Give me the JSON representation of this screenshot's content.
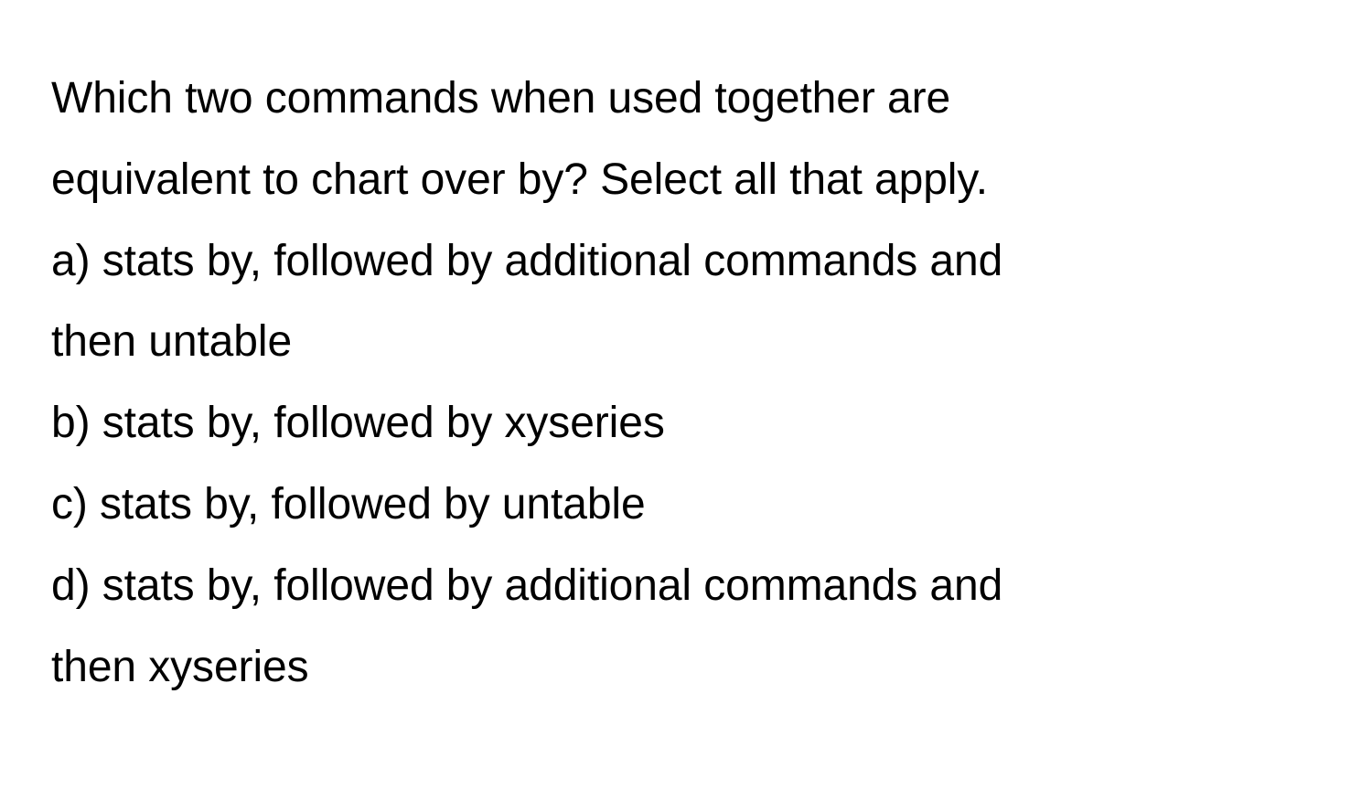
{
  "question": {
    "line1": "Which two commands when used together are",
    "line2": "equivalent to chart over by? Select all that apply."
  },
  "options": {
    "a_line1": "a) stats by, followed by additional commands and",
    "a_line2": "then untable",
    "b": "b) stats by, followed by xyseries",
    "c": "c) stats by, followed by untable",
    "d_line1": "d) stats by, followed by additional commands and",
    "d_line2": "then xyseries"
  }
}
